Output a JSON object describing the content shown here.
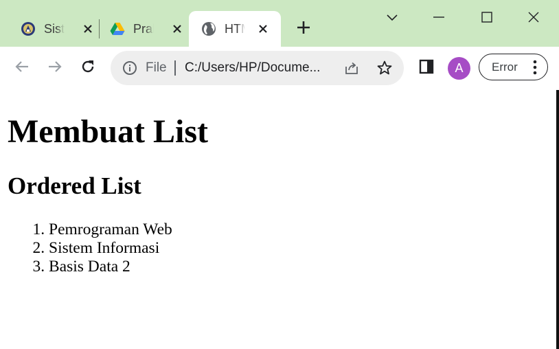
{
  "browser": {
    "tabs": [
      {
        "title": "Siste",
        "favicon": "university-seal-icon",
        "active": false
      },
      {
        "title": "Prak",
        "favicon": "google-drive-icon",
        "active": false
      },
      {
        "title": "HTML",
        "favicon": "globe-icon",
        "active": true
      }
    ],
    "new_tab_icon": "plus-icon",
    "window_controls": [
      "chevron-down-icon",
      "minimize-icon",
      "maximize-icon",
      "close-icon"
    ]
  },
  "toolbar": {
    "scheme_label": "File",
    "url": "C:/Users/HP/Docume...",
    "avatar_letter": "A",
    "error_label": "Error",
    "icons": [
      "back-arrow-icon",
      "forward-arrow-icon",
      "reload-icon",
      "info-icon",
      "share-icon",
      "star-icon",
      "side-panel-icon",
      "kebab-menu-icon"
    ]
  },
  "page": {
    "h1": "Membuat List",
    "h2": "Ordered List",
    "list_items": [
      "Pemrograman Web",
      "Sistem Informasi",
      "Basis Data 2"
    ]
  },
  "colors": {
    "tabstrip": "#cce8c2",
    "avatar": "#a64cc5",
    "omnibox": "#eeeeee",
    "text": "#000000"
  }
}
